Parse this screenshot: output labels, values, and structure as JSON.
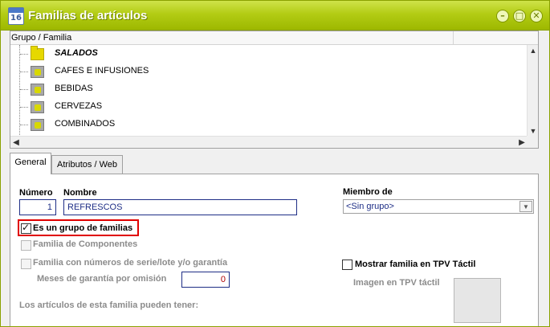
{
  "window": {
    "title": "Familias de artículos",
    "icon_label": "16"
  },
  "tree": {
    "column_header": "Grupo / Familia",
    "rows": [
      {
        "label": "SALADOS",
        "icon": "folder-icon",
        "bold": true
      },
      {
        "label": "CAFES E INFUSIONES",
        "icon": "puzzle-icon"
      },
      {
        "label": "BEBIDAS",
        "icon": "puzzle-icon"
      },
      {
        "label": "CERVEZAS",
        "icon": "puzzle-icon"
      },
      {
        "label": "COMBINADOS",
        "icon": "puzzle-icon"
      }
    ]
  },
  "tabs": [
    {
      "label": "General",
      "active": true
    },
    {
      "label": "Atributos / Web",
      "active": false
    }
  ],
  "general": {
    "numero_label": "Número",
    "numero_value": "1",
    "nombre_label": "Nombre",
    "nombre_value": "REFRESCOS",
    "miembro_label": "Miembro de",
    "miembro_value": "<Sin grupo>",
    "grupo_label": "Es un grupo de familias",
    "componentes_label": "Familia de Componentes",
    "serie_label": "Familia con números de serie/lote y/o garantía",
    "meses_label": "Meses de garantía por omisión",
    "meses_value": "0",
    "tpv_label": "Mostrar familia en TPV Táctil",
    "imagen_label": "Imagen en TPV táctil",
    "articulos_label": "Los artículos de esta familia pueden tener:"
  },
  "colors": {
    "titlebar": "#b3cc14",
    "highlight": "#e00000",
    "input_text": "#1e2e86"
  }
}
